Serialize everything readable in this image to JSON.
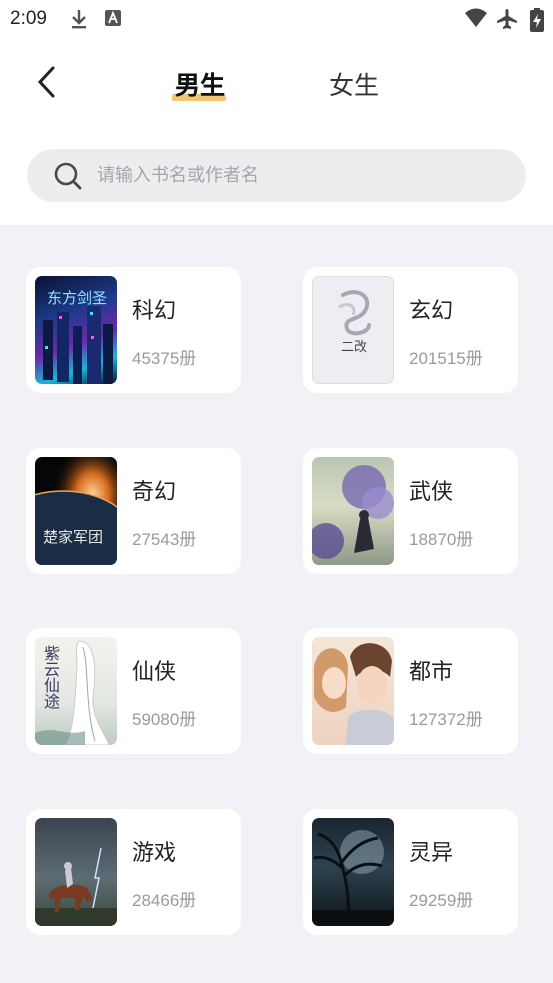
{
  "status_bar": {
    "time": "2:09"
  },
  "header": {
    "tabs": [
      {
        "label": "男生",
        "active": true
      },
      {
        "label": "女生",
        "active": false
      }
    ],
    "accent_color": "#f3c575"
  },
  "search": {
    "placeholder": "请输入书名或作者名"
  },
  "categories": [
    {
      "name": "科幻",
      "count": "45375册",
      "cover_text": "东方剑圣"
    },
    {
      "name": "玄幻",
      "count": "201515册",
      "cover_text": "二改"
    },
    {
      "name": "奇幻",
      "count": "27543册",
      "cover_text": "楚家军团"
    },
    {
      "name": "武侠",
      "count": "18870册",
      "cover_text": ""
    },
    {
      "name": "仙侠",
      "count": "59080册",
      "cover_text": "紫云仙途"
    },
    {
      "name": "都市",
      "count": "127372册",
      "cover_text": ""
    },
    {
      "name": "游戏",
      "count": "28466册",
      "cover_text": ""
    },
    {
      "name": "灵异",
      "count": "29259册",
      "cover_text": ""
    }
  ]
}
